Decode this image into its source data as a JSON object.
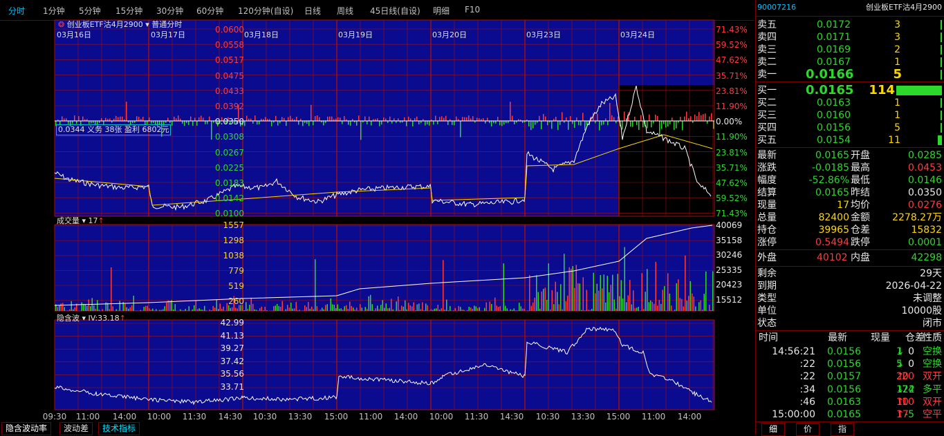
{
  "periods": [
    "分时",
    "1分钟",
    "5分钟",
    "15分钟",
    "30分钟",
    "60分钟",
    "120分钟(自设)",
    "日线",
    "周线",
    "45日线(自设)",
    "明细",
    "F10"
  ],
  "contract_select": "创业板ETF沽4月2900",
  "chart_mode": "普通分时",
  "price_axis_left": [
    "0.0600",
    "0.0558",
    "0.0517",
    "0.0475",
    "0.0433",
    "0.0392",
    "0.0350",
    "0.0308",
    "0.0267",
    "0.0225",
    "0.0183",
    "0.0142",
    "0.0100"
  ],
  "price_axis_right": [
    "71.43%",
    "59.52%",
    "47.62%",
    "35.71%",
    "23.81%",
    "11.90%",
    "0.00%",
    "11.90%",
    "23.81%",
    "35.71%",
    "47.62%",
    "59.52%",
    "71.43%"
  ],
  "dates": [
    "03月16日",
    "03月17日",
    "03月18日",
    "03月19日",
    "03月20日",
    "03月23日",
    "03月24日"
  ],
  "position_note": "0.0344 义务  38张  盈利 6802元",
  "volume_label": "成交量",
  "volume_value": "17",
  "volume_axis_left": [
    "1557",
    "1298",
    "1038",
    "779",
    "519",
    "260"
  ],
  "volume_axis_right": [
    "40069",
    "35158",
    "30246",
    "25335",
    "20423",
    "15512"
  ],
  "iv_label": "隐含波",
  "iv_value": "IV:33.18",
  "iv_axis": [
    "42.99",
    "41.13",
    "39.27",
    "37.42",
    "35.56",
    "33.71"
  ],
  "time_axis": [
    "09:30",
    "11:00",
    "14:00",
    "10:00",
    "11:30",
    "14:30",
    "10:30",
    "13:30",
    "15:00",
    "11:00",
    "14:00",
    "10:00",
    "11:30",
    "14:30",
    "10:30",
    "13:30",
    "15:00",
    "11:00",
    "14:00"
  ],
  "bottom_tabs": [
    "隐含波动率",
    "波动差",
    "技术指标"
  ],
  "right": {
    "code": "90007216",
    "name": "创业板ETF沽4月2900",
    "asks": [
      {
        "label": "卖五",
        "price": "0.0172",
        "vol": "3"
      },
      {
        "label": "卖四",
        "price": "0.0171",
        "vol": "3"
      },
      {
        "label": "卖三",
        "price": "0.0169",
        "vol": "2"
      },
      {
        "label": "卖二",
        "price": "0.0167",
        "vol": "1"
      },
      {
        "label": "卖一",
        "price": "0.0166",
        "vol": "5"
      }
    ],
    "bids": [
      {
        "label": "买一",
        "price": "0.0165",
        "vol": "114"
      },
      {
        "label": "买二",
        "price": "0.0163",
        "vol": "1"
      },
      {
        "label": "买三",
        "price": "0.0160",
        "vol": "1"
      },
      {
        "label": "买四",
        "price": "0.0156",
        "vol": "5"
      },
      {
        "label": "买五",
        "price": "0.0154",
        "vol": "11"
      }
    ],
    "stats": [
      {
        "l1": "最新",
        "v1": "0.0165",
        "l2": "开盘",
        "v2": "0.0285"
      },
      {
        "l1": "涨跌",
        "v1": "-0.0185",
        "l2": "最高",
        "v2": "0.0453"
      },
      {
        "l1": "幅度",
        "v1": "-52.86%",
        "l2": "最低",
        "v2": "0.0146"
      },
      {
        "l1": "结算",
        "v1": "0.0165",
        "l2": "昨结",
        "v2": "0.0350"
      },
      {
        "l1": "现量",
        "v1": "17",
        "l2": "均价",
        "v2": "0.0276"
      },
      {
        "l1": "总量",
        "v1": "82400",
        "l2": "金额",
        "v2": "2278.27万"
      },
      {
        "l1": "持仓",
        "v1": "39965",
        "l2": "仓差",
        "v2": "15832"
      },
      {
        "l1": "涨停",
        "v1": "0.5494",
        "l2": "跌停",
        "v2": "0.0001"
      }
    ],
    "outer_label": "外盘",
    "outer_value": "40102",
    "inner_label": "内盘",
    "inner_value": "42298",
    "info": [
      {
        "label": "剩余",
        "value": "29天"
      },
      {
        "label": "到期",
        "value": "2026-04-22"
      },
      {
        "label": "类型",
        "value": "未调整"
      },
      {
        "label": "单位",
        "value": "10000股"
      },
      {
        "label": "状态",
        "value": "闭市"
      }
    ],
    "tick_headers": [
      "时间",
      "最新",
      "现量",
      "仓差",
      "性质"
    ],
    "ticks": [
      {
        "time": "14:56:21",
        "price": "0.0156",
        "vol": "1",
        "dir": "down",
        "diff": "0",
        "nature": "空换"
      },
      {
        "time": ":22",
        "price": "0.0156",
        "vol": "5",
        "dir": "down",
        "diff": "0",
        "nature": "空换"
      },
      {
        "time": ":22",
        "price": "0.0157",
        "vol": "20",
        "dir": "up",
        "diff": "20",
        "nature": "双开"
      },
      {
        "time": ":34",
        "price": "0.0156",
        "vol": "122",
        "dir": "down",
        "diff": "-74",
        "nature": "多平"
      },
      {
        "time": ":46",
        "price": "0.0163",
        "vol": "10",
        "dir": "up",
        "diff": "10",
        "nature": "双开"
      },
      {
        "time": "15:00:00",
        "price": "0.0165",
        "vol": "17",
        "dir": "up",
        "diff": "-5",
        "nature": "空平"
      }
    ],
    "bottom_tabs": [
      "细",
      "价",
      "指"
    ]
  },
  "colors": {
    "chart_bg": "#0b0b8f",
    "grid": "#a01010",
    "up": "#ff3b3b",
    "down": "#2dd82d",
    "price_line": "#ffffff",
    "avg_line": "#ffd700"
  }
}
